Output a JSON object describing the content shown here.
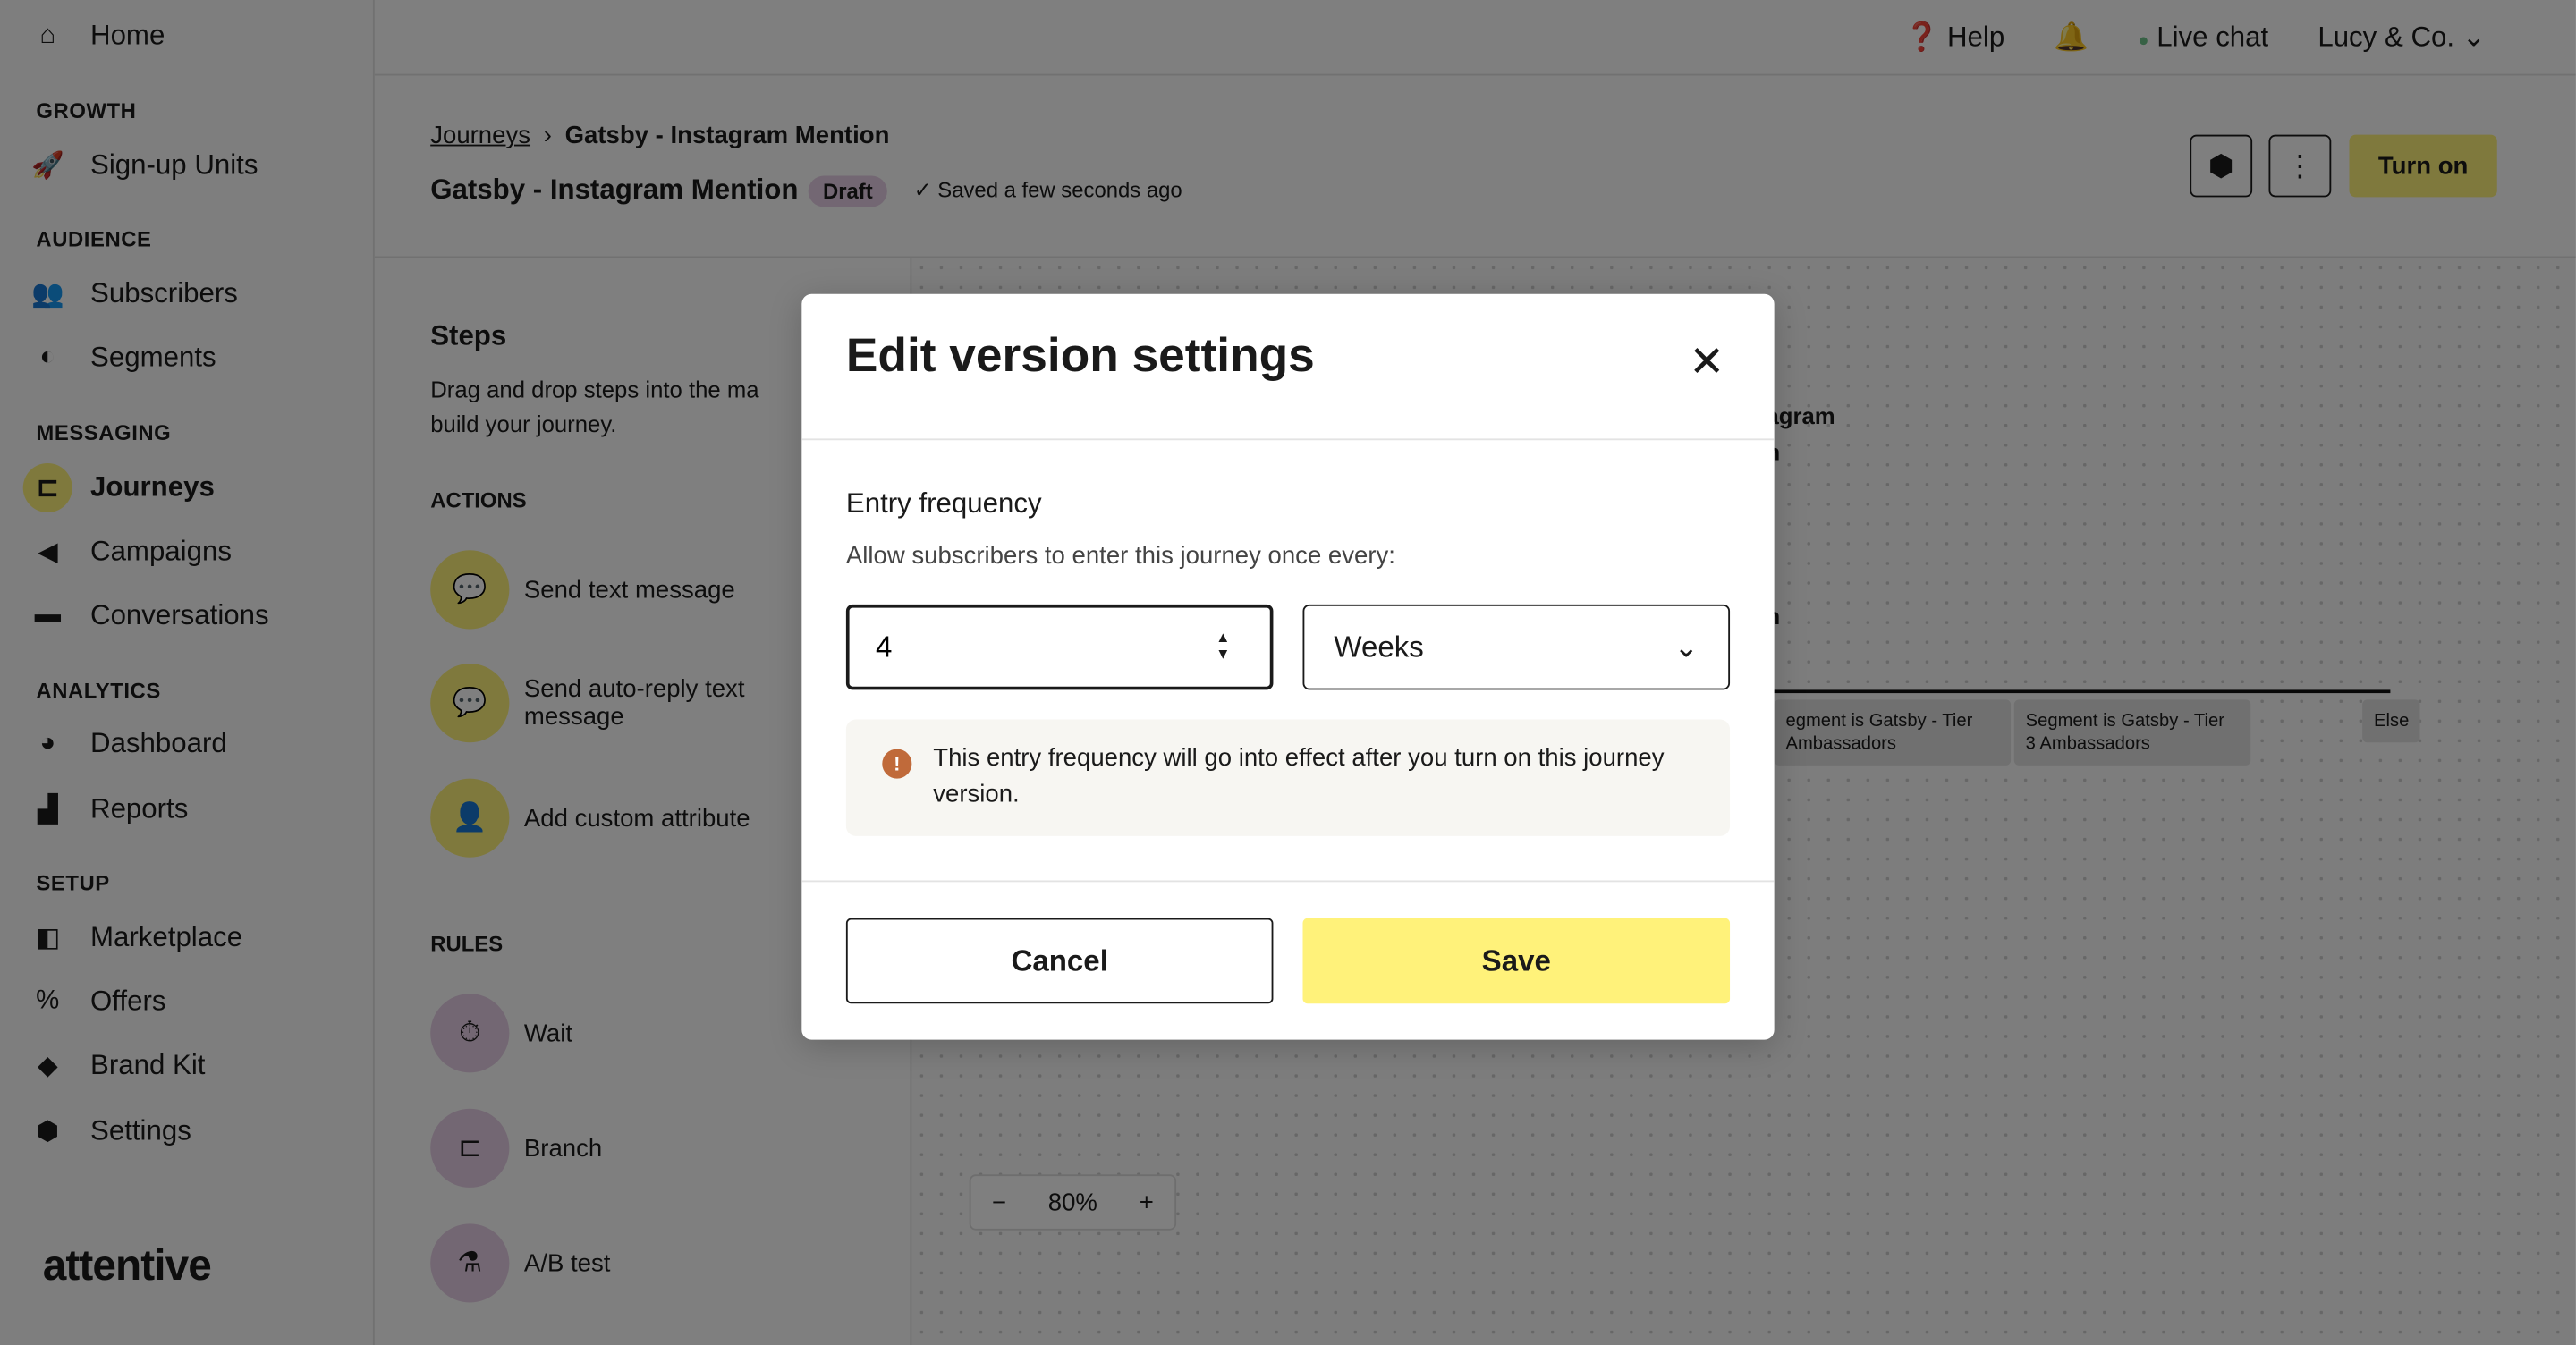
{
  "sidebar": {
    "home": "Home",
    "sections": {
      "growth": "GROWTH",
      "audience": "AUDIENCE",
      "messaging": "MESSAGING",
      "analytics": "ANALYTICS",
      "setup": "SETUP"
    },
    "items": {
      "signup": "Sign-up Units",
      "subscribers": "Subscribers",
      "segments": "Segments",
      "journeys": "Journeys",
      "campaigns": "Campaigns",
      "conversations": "Conversations",
      "dashboard": "Dashboard",
      "reports": "Reports",
      "marketplace": "Marketplace",
      "offers": "Offers",
      "brandkit": "Brand Kit",
      "settings": "Settings"
    },
    "active": "Journeys",
    "logo": "attentive"
  },
  "topbar": {
    "help": "Help",
    "live_chat": "Live chat",
    "account": "Lucy & Co."
  },
  "header": {
    "breadcrumb_root": "Journeys",
    "breadcrumb_current": "Gatsby - Instagram Mention",
    "title": "Gatsby - Instagram Mention",
    "status": "Draft",
    "saved": "Saved a few seconds ago",
    "turn_on": "Turn on"
  },
  "steps": {
    "title": "Steps",
    "description_1": "Drag and drop steps into the ma",
    "description_2": "build your journey.",
    "actions_label": "ACTIONS",
    "actions": [
      "Send text message",
      "Send auto-reply text",
      "message",
      "Add custom attribute"
    ],
    "rules_label": "RULES",
    "rules": [
      "Wait",
      "Branch",
      "A/B test"
    ]
  },
  "canvas": {
    "frag1": "agram",
    "frag2": "n",
    "frag3": "n",
    "nodes": [
      "egment is Gatsby - Tier",
      "Ambassadors",
      "Segment is Gatsby - Tier",
      "3 Ambassadors",
      "Else"
    ],
    "zoom": "80%"
  },
  "modal": {
    "title": "Edit version settings",
    "field_label": "Entry frequency",
    "help": "Allow subscribers to enter this journey once every:",
    "value": "4",
    "unit": "Weeks",
    "notice": "This entry frequency will go into effect after you turn on this journey version.",
    "cancel": "Cancel",
    "save": "Save"
  },
  "colors": {
    "accent": "#fff27a",
    "draft_badge": "#e7cfe6",
    "info": "#c06a3a"
  }
}
